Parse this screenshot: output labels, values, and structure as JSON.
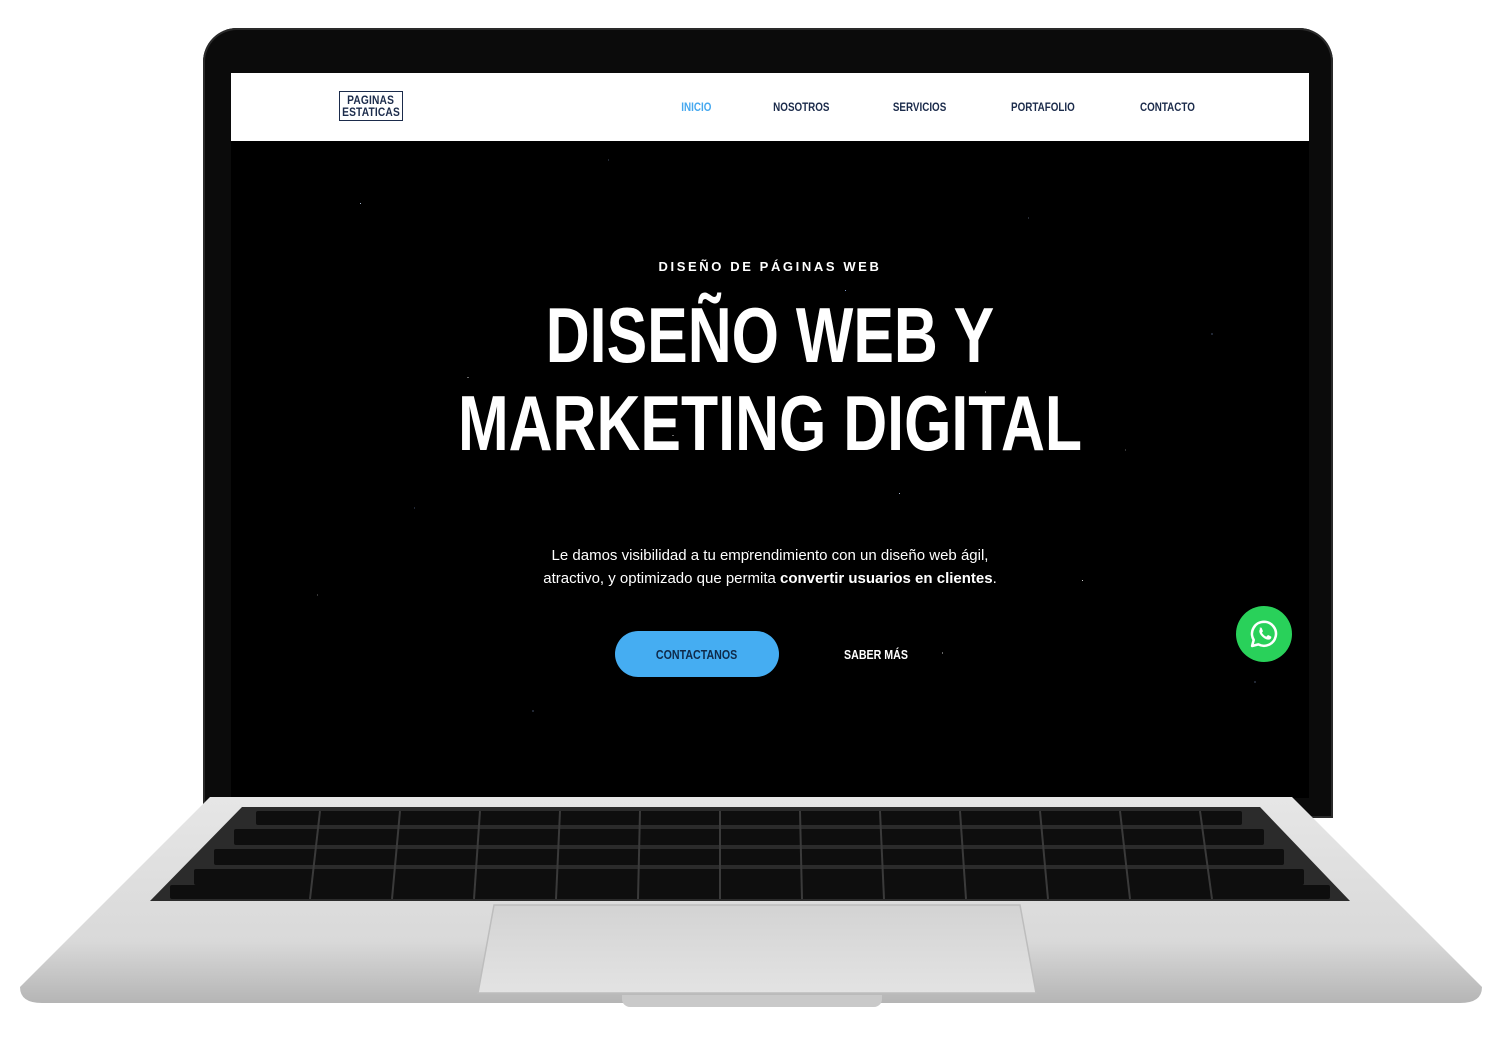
{
  "navbar": {
    "logo_line1": "PAGINAS",
    "logo_line2": "ESTATICAS",
    "items": [
      {
        "label": "INICIO",
        "active": true
      },
      {
        "label": "NOSOTROS",
        "active": false
      },
      {
        "label": "SERVICIOS",
        "active": false
      },
      {
        "label": "PORTAFOLIO",
        "active": false
      },
      {
        "label": "CONTACTO",
        "active": false
      }
    ]
  },
  "hero": {
    "eyebrow": "DISEÑO DE PÁGINAS WEB",
    "headline_line1": "DISEÑO WEB Y",
    "headline_line2": "MARKETING DIGITAL",
    "lead_part1": "Le damos visibilidad a tu emprendimiento con un diseño web ágil,",
    "lead_part2": "atractivo, y optimizado que permita ",
    "lead_bold": "convertir usuarios en clientes",
    "lead_end": ".",
    "primary_button": "CONTACTANOS",
    "secondary_button": "SABER MÁS"
  },
  "floating": {
    "whatsapp_icon": "whatsapp-icon"
  },
  "colors": {
    "accent": "#45adf2",
    "active_nav": "#45a8ef",
    "nav_text": "#1b2b4b",
    "whatsapp": "#29d15a"
  }
}
